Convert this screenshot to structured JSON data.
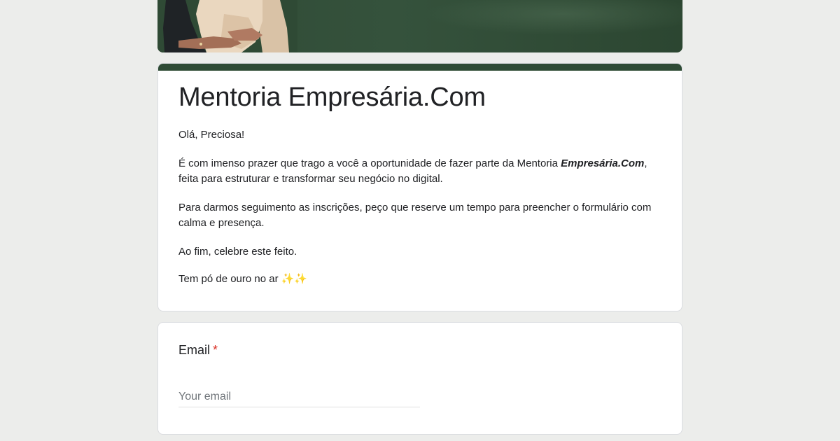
{
  "form": {
    "title": "Mentoria Empresária.Com",
    "description": {
      "greeting": "Olá, Preciosa!",
      "para1_start": "É com imenso prazer que trago a você a oportunidade de fazer parte da Mentoria ",
      "para1_emphasis": "Empresária.Com",
      "para1_end": ", feita para estruturar e transformar seu negócio no digital.",
      "para2": "Para darmos seguimento as inscrições, peço que reserve um tempo para preencher o formulário com calma e presença.",
      "para3": "Ao fim, celebre este feito.",
      "para4": "Tem pó de ouro no ar ✨✨"
    }
  },
  "questions": [
    {
      "label": "Email",
      "required_marker": "*",
      "placeholder": "Your email",
      "value": ""
    }
  ],
  "colors": {
    "theme": "#2e4b35",
    "background": "#ecedeb",
    "required": "#d93025"
  }
}
